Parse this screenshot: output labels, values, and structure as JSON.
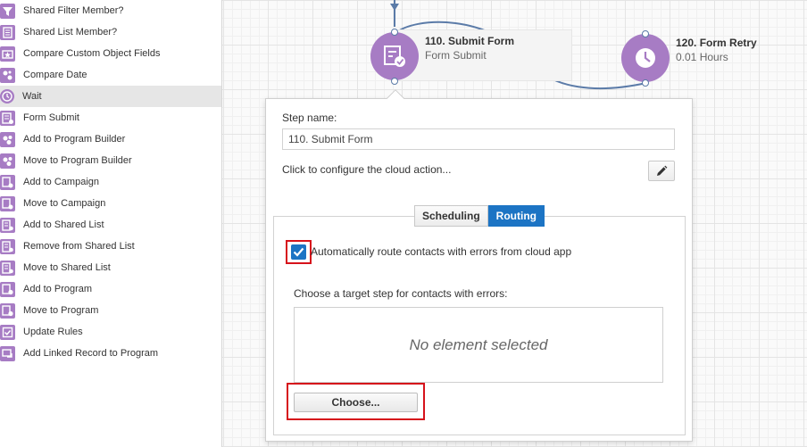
{
  "palette": {
    "items": [
      {
        "label": "Shared Filter Member?",
        "icon": "filter-icon"
      },
      {
        "label": "Shared List Member?",
        "icon": "list-icon"
      },
      {
        "label": "Compare Custom Object Fields",
        "icon": "custom-object-icon"
      },
      {
        "label": "Compare Date",
        "icon": "date-icon"
      },
      {
        "label": "Wait",
        "icon": "clock-icon",
        "selected": true
      },
      {
        "label": "Form Submit",
        "icon": "form-icon"
      },
      {
        "label": "Add to Program Builder",
        "icon": "program-builder-icon"
      },
      {
        "label": "Move to Program Builder",
        "icon": "program-builder-icon"
      },
      {
        "label": "Add to Campaign",
        "icon": "campaign-icon"
      },
      {
        "label": "Move to Campaign",
        "icon": "campaign-icon"
      },
      {
        "label": "Add to Shared List",
        "icon": "shared-list-icon"
      },
      {
        "label": "Remove from Shared List",
        "icon": "shared-list-icon"
      },
      {
        "label": "Move to Shared List",
        "icon": "shared-list-icon"
      },
      {
        "label": "Add to Program",
        "icon": "program-icon"
      },
      {
        "label": "Move to Program",
        "icon": "program-icon"
      },
      {
        "label": "Update Rules",
        "icon": "update-rules-icon"
      },
      {
        "label": "Add Linked Record to Program",
        "icon": "linked-record-icon"
      }
    ]
  },
  "canvas": {
    "nodes": [
      {
        "title": "110. Submit Form",
        "subtitle": "Form Submit",
        "icon": "form-submit-icon"
      },
      {
        "title": "120. Form Retry",
        "subtitle": "0.01 Hours",
        "icon": "clock-icon"
      }
    ]
  },
  "panel": {
    "step_name_label": "Step name:",
    "step_name_value": "110. Submit Form",
    "cloud_action_text": "Click to configure the cloud action...",
    "tabs": [
      {
        "label": "Scheduling",
        "active": false
      },
      {
        "label": "Routing",
        "active": true
      }
    ],
    "auto_route_checked": true,
    "auto_route_label": "Automatically route contacts with errors from cloud app",
    "target_label": "Choose a target step for contacts with errors:",
    "target_empty_text": "No element selected",
    "choose_button_label": "Choose..."
  },
  "colors": {
    "node_purple": "#a77cc4",
    "accent_blue": "#1c74c4",
    "connector_blue": "#5b7ba8",
    "highlight_red": "#d6121b"
  }
}
